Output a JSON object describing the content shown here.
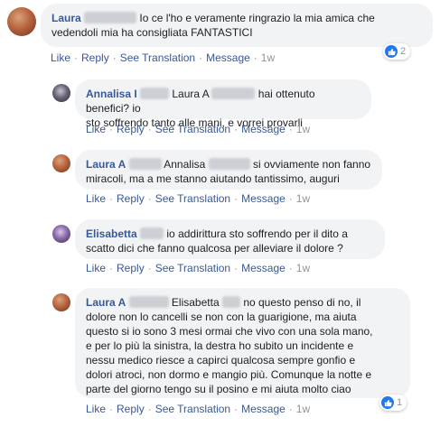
{
  "actions": {
    "like": "Like",
    "reply": "Reply",
    "translation": "See Translation",
    "message": "Message",
    "separator": "·"
  },
  "comments": [
    {
      "author": "Laura",
      "text_line1": "Io ce l'ho e veramente ringrazio la mia amica che",
      "text_line2": "vedendoli mia ha consigliata FANTASTICI",
      "time": "1w",
      "reactions": "2"
    },
    {
      "author": "Annalisa I",
      "mention": "Laura A",
      "text_line1_tail": "hai ottenuto benefici? io",
      "text_line2": "sto soffrendo tanto alle mani, e vorrei provarli",
      "time": "1w"
    },
    {
      "author": "Laura A",
      "mention": "Annalisa",
      "text_line1_tail": "si ovviamente non fanno",
      "text_line2": "miracoli, ma a me stanno aiutando tantissimo, auguri",
      "time": "1w"
    },
    {
      "author": "Elisabetta",
      "text_line1_tail": "io addirittura sto soffrendo per il dito a",
      "text_line2": "scatto dici che fanno qualcosa per alleviare il dolore ?",
      "time": "1w"
    },
    {
      "author": "Laura A",
      "mention": "Elisabetta",
      "text_line1_tail": "no questo penso di no, il",
      "lines": [
        "dolore non lo cancelli se non con la guarigione, ma aiuta",
        "questo si io sono 3 mesi ormai che vivo con una sola mano,",
        "e per lo più la sinistra, la destra ho subito un incidente e",
        "nessu medico riesce a capirci qualcosa sempre gonfio e",
        "dolori atroci, non dormo e mangio più. Comunque la notte e",
        "parte del giorno tengo su il posino e mi aiuta molto ciao"
      ],
      "time": "1w",
      "reactions": "1"
    }
  ]
}
